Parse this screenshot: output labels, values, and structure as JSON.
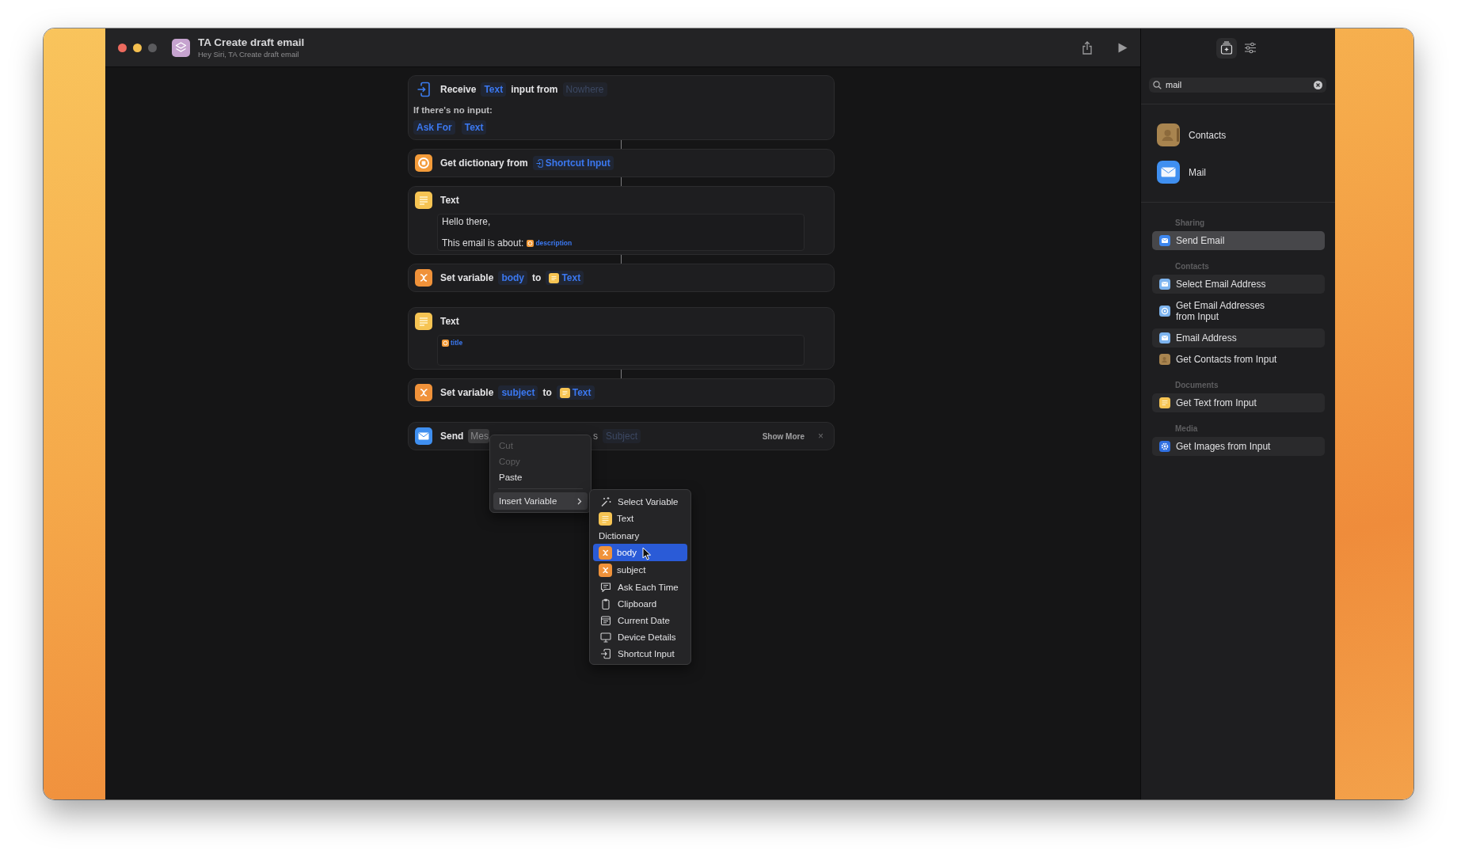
{
  "window": {
    "title": "TA Create draft email",
    "subtitle": "Hey Siri, TA Create draft email"
  },
  "action_chains": [
    {
      "actions": [
        {
          "kind": "receive",
          "header": [
            {
              "kind": "label",
              "text": "Receive"
            },
            {
              "kind": "param",
              "text": "Text"
            },
            {
              "kind": "label",
              "text": "input from"
            },
            {
              "kind": "placeholder",
              "text": "Nowhere"
            }
          ],
          "note": "If there's no input:",
          "options": [
            {
              "kind": "param",
              "text": "Ask For"
            },
            {
              "kind": "param",
              "text": "Text"
            }
          ]
        },
        {
          "kind": "dictionary",
          "header": [
            {
              "kind": "label",
              "text": "Get dictionary from"
            },
            {
              "kind": "input_var",
              "text": "Shortcut Input"
            }
          ]
        },
        {
          "kind": "text",
          "header": [
            {
              "kind": "label",
              "text": "Text"
            }
          ],
          "lines": [
            {
              "segments": [
                {
                  "kind": "plain",
                  "text": "Hello there,"
                }
              ]
            },
            {
              "segments": [
                {
                  "kind": "plain",
                  "text": "This email is about:"
                },
                {
                  "kind": "dict_var",
                  "text": "description"
                }
              ]
            }
          ]
        },
        {
          "kind": "variable",
          "header": [
            {
              "kind": "label",
              "text": "Set variable"
            },
            {
              "kind": "param",
              "text": "body"
            },
            {
              "kind": "label",
              "text": "to"
            },
            {
              "kind": "text_var",
              "text": "Text"
            }
          ]
        }
      ]
    },
    {
      "actions": [
        {
          "kind": "text",
          "header": [
            {
              "kind": "label",
              "text": "Text"
            }
          ],
          "lines": [
            {
              "segments": [
                {
                  "kind": "dict_var",
                  "text": "title"
                }
              ]
            }
          ]
        },
        {
          "kind": "variable",
          "header": [
            {
              "kind": "label",
              "text": "Set variable"
            },
            {
              "kind": "param",
              "text": "subject"
            },
            {
              "kind": "label",
              "text": "to"
            },
            {
              "kind": "text_var",
              "text": "Text"
            }
          ]
        }
      ]
    },
    {
      "actions": [
        {
          "kind": "mail",
          "header": [
            {
              "kind": "label",
              "text": "Send"
            },
            {
              "kind": "editing",
              "text": "Mes"
            },
            {
              "kind": "fragment",
              "text": "s"
            },
            {
              "kind": "placeholder",
              "text": "Subject"
            }
          ],
          "show_more": "Show More",
          "close": "×"
        }
      ]
    }
  ],
  "context_menu": {
    "items": [
      {
        "kind": "item",
        "label": "Cut",
        "disabled": true,
        "selected": false
      },
      {
        "kind": "item",
        "label": "Copy",
        "disabled": true,
        "selected": false
      },
      {
        "kind": "item",
        "label": "Paste",
        "disabled": false,
        "selected": false
      },
      {
        "kind": "separator"
      },
      {
        "kind": "submenu",
        "label": "Insert Variable",
        "disabled": false,
        "selected": true
      }
    ]
  },
  "submenu": {
    "items": [
      {
        "kind": "wand",
        "label": "Select Variable",
        "selected": false
      },
      {
        "kind": "text",
        "label": "Text",
        "selected": false
      },
      {
        "kind": "heading",
        "label": "Dictionary",
        "selected": false
      },
      {
        "kind": "variable",
        "label": "body",
        "selected": true
      },
      {
        "kind": "variable",
        "label": "subject",
        "selected": false
      },
      {
        "kind": "bubble",
        "label": "Ask Each Time",
        "selected": false
      },
      {
        "kind": "clipboard",
        "label": "Clipboard",
        "selected": false
      },
      {
        "kind": "calendar",
        "label": "Current Date",
        "selected": false
      },
      {
        "kind": "monitor",
        "label": "Device Details",
        "selected": false
      },
      {
        "kind": "input",
        "label": "Shortcut Input",
        "selected": false
      }
    ]
  },
  "sidebar": {
    "tabs": [
      {
        "kind": "library",
        "selected": true
      },
      {
        "kind": "settings",
        "selected": false
      }
    ],
    "search": {
      "value": "mail"
    },
    "apps": [
      {
        "kind": "contacts",
        "name": "Contacts"
      },
      {
        "kind": "mail",
        "name": "Mail"
      }
    ],
    "sections": [
      {
        "title": "Sharing",
        "items": [
          {
            "kind": "mail",
            "label": "Send Email",
            "selected": true,
            "shaded": false
          }
        ]
      },
      {
        "title": "Contacts",
        "items": [
          {
            "kind": "envelope",
            "label": "Select Email Address",
            "selected": false,
            "shaded": true
          },
          {
            "kind": "ring",
            "label": "Get Email Addresses from Input",
            "selected": false,
            "shaded": false
          },
          {
            "kind": "envelope",
            "label": "Email Address",
            "selected": false,
            "shaded": true
          },
          {
            "kind": "contacts",
            "label": "Get Contacts from Input",
            "selected": false,
            "shaded": false
          }
        ]
      },
      {
        "title": "Documents",
        "items": [
          {
            "kind": "text",
            "label": "Get Text from Input",
            "selected": false,
            "shaded": true
          }
        ]
      },
      {
        "title": "Media",
        "items": [
          {
            "kind": "photos",
            "label": "Get Images from Input",
            "selected": false,
            "shaded": true
          }
        ]
      }
    ]
  }
}
